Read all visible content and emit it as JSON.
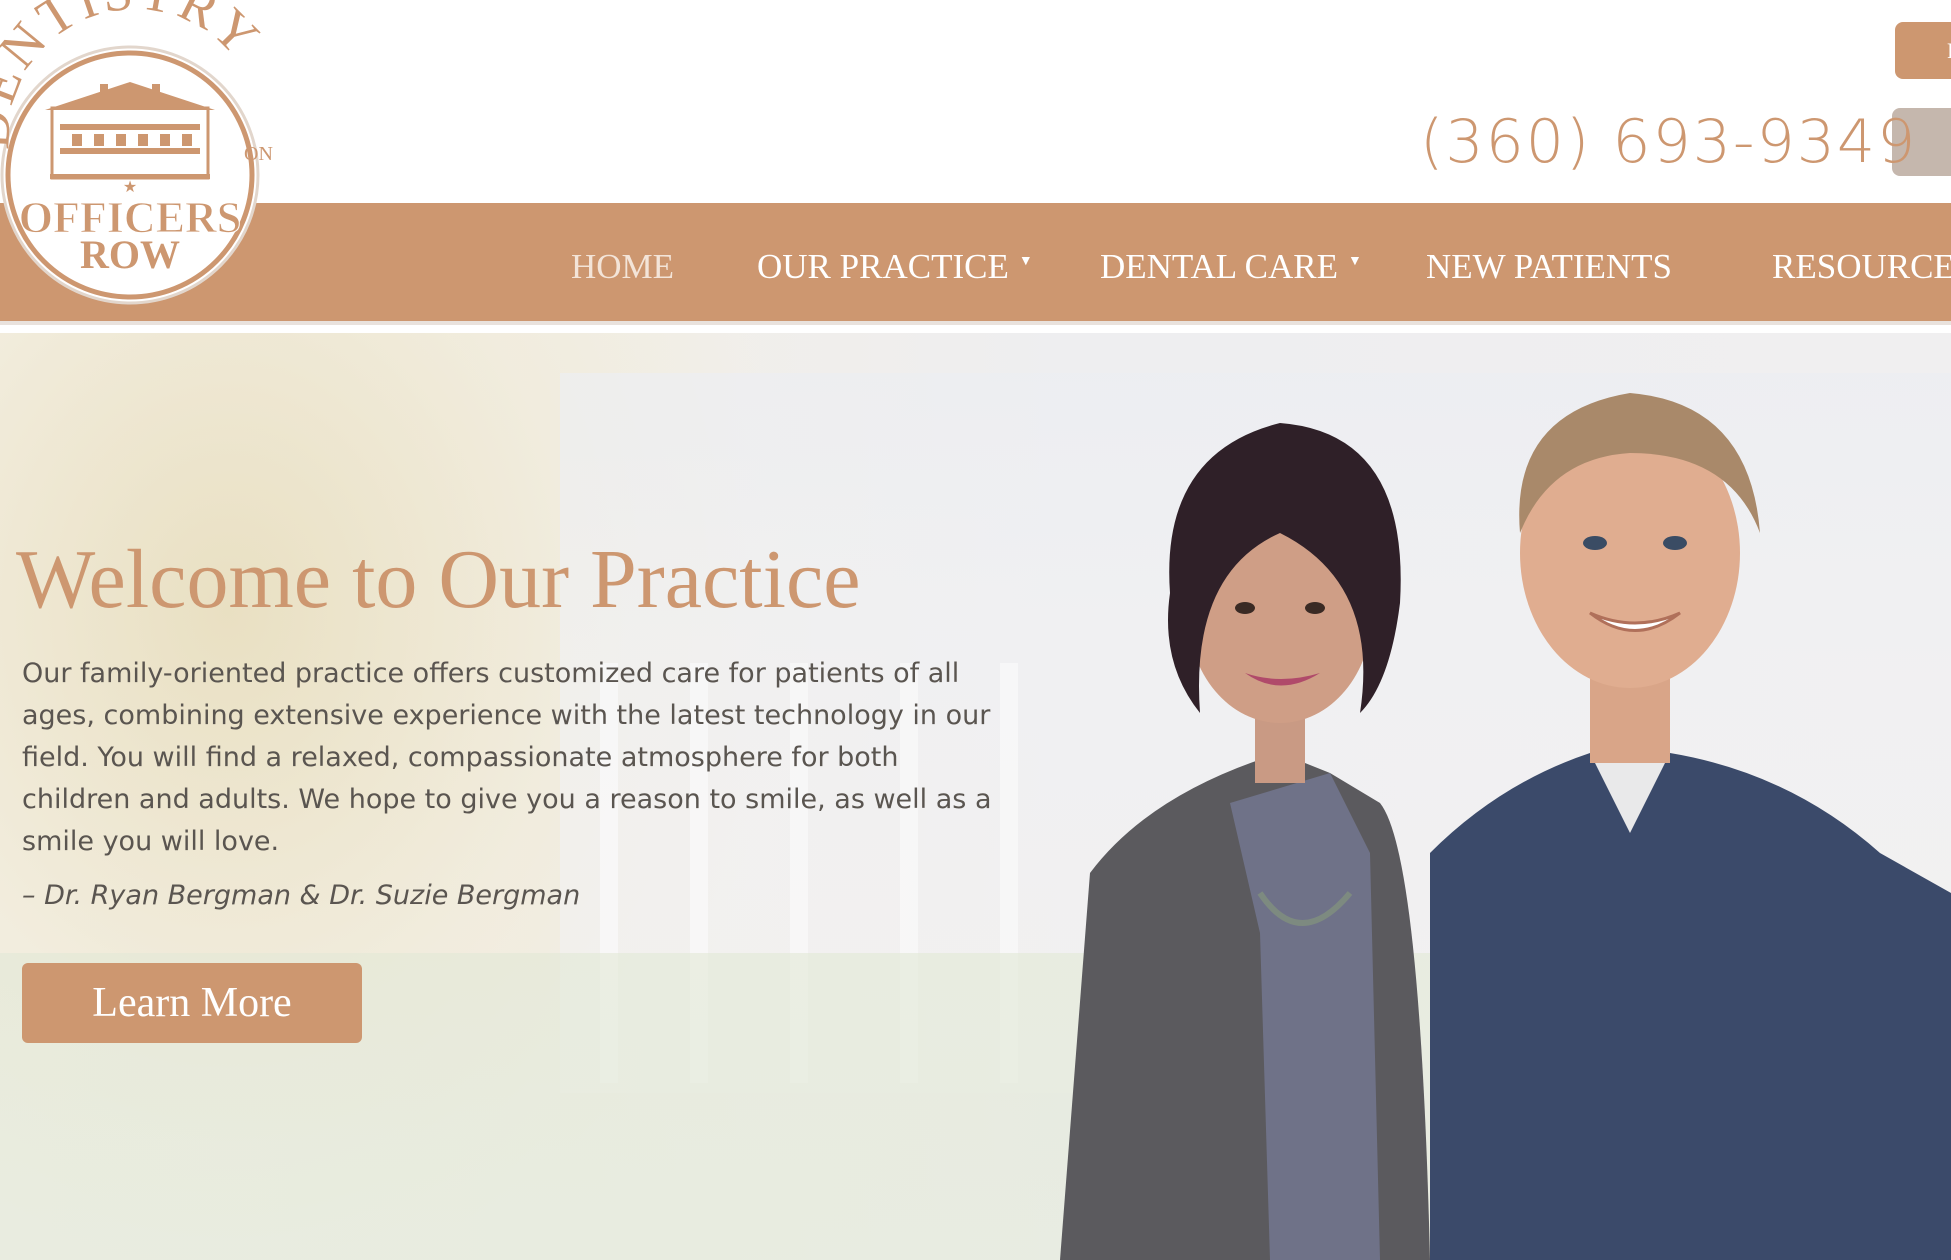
{
  "brand": {
    "logo_top": "DENTISTRY",
    "logo_on": "ON",
    "logo_line1": "OFFICERS",
    "logo_line2": "ROW",
    "accent_color": "#cd9770"
  },
  "header": {
    "top_button_1_label": "F",
    "phone": "(360) 693-9349"
  },
  "nav": {
    "items": [
      {
        "label": "HOME",
        "has_dropdown": false
      },
      {
        "label": "OUR PRACTICE",
        "has_dropdown": true
      },
      {
        "label": "DENTAL CARE",
        "has_dropdown": true
      },
      {
        "label": "NEW PATIENTS",
        "has_dropdown": false
      },
      {
        "label": "RESOURCE",
        "has_dropdown": false
      }
    ]
  },
  "hero": {
    "title": "Welcome to Our Practice",
    "lines": [
      "Our family-oriented practice offers customized care for patients of all",
      "ages, combining extensive experience with the latest technology in our",
      "field. You will find a relaxed, compassionate atmosphere for both",
      "children and adults. We hope to give you a reason to smile, as well as a",
      "smile you will love."
    ],
    "signature": "– Dr. Ryan Bergman & Dr. Suzie Bergman",
    "cta_label": "Learn More"
  }
}
